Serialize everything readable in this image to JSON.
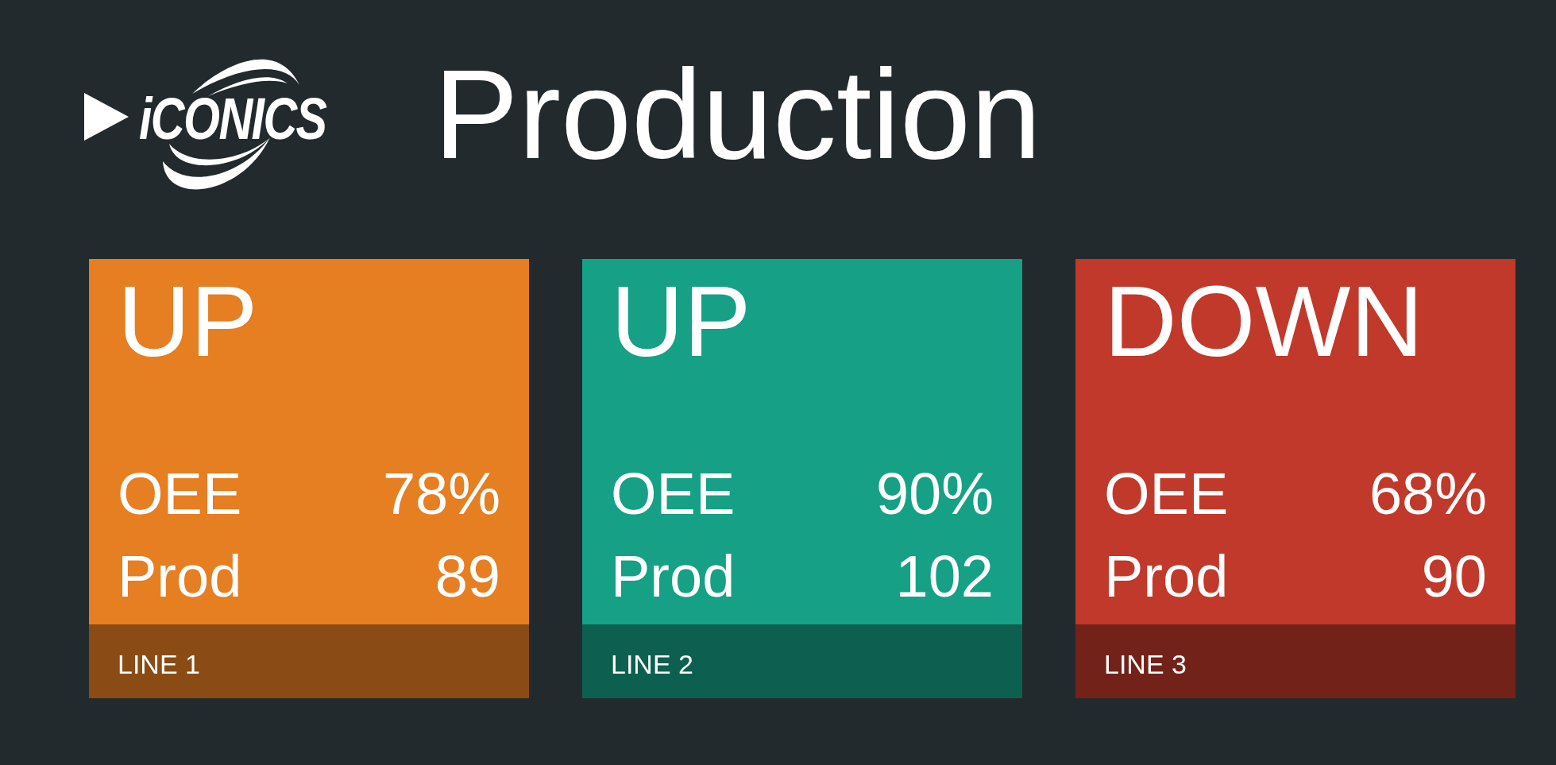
{
  "logo": {
    "text": "iCONICS"
  },
  "title": "Production",
  "tiles": [
    {
      "status": "UP",
      "color": "#e67e22",
      "metrics": [
        {
          "label": "OEE",
          "value": "78%"
        },
        {
          "label": "Prod",
          "value": "89"
        }
      ],
      "line": "LINE 1"
    },
    {
      "status": "UP",
      "color": "#16a085",
      "metrics": [
        {
          "label": "OEE",
          "value": "90%"
        },
        {
          "label": "Prod",
          "value": "102"
        }
      ],
      "line": "LINE 2"
    },
    {
      "status": "DOWN",
      "color": "#c0392b",
      "metrics": [
        {
          "label": "OEE",
          "value": "68%"
        },
        {
          "label": "Prod",
          "value": "90"
        }
      ],
      "line": "LINE 3"
    }
  ]
}
